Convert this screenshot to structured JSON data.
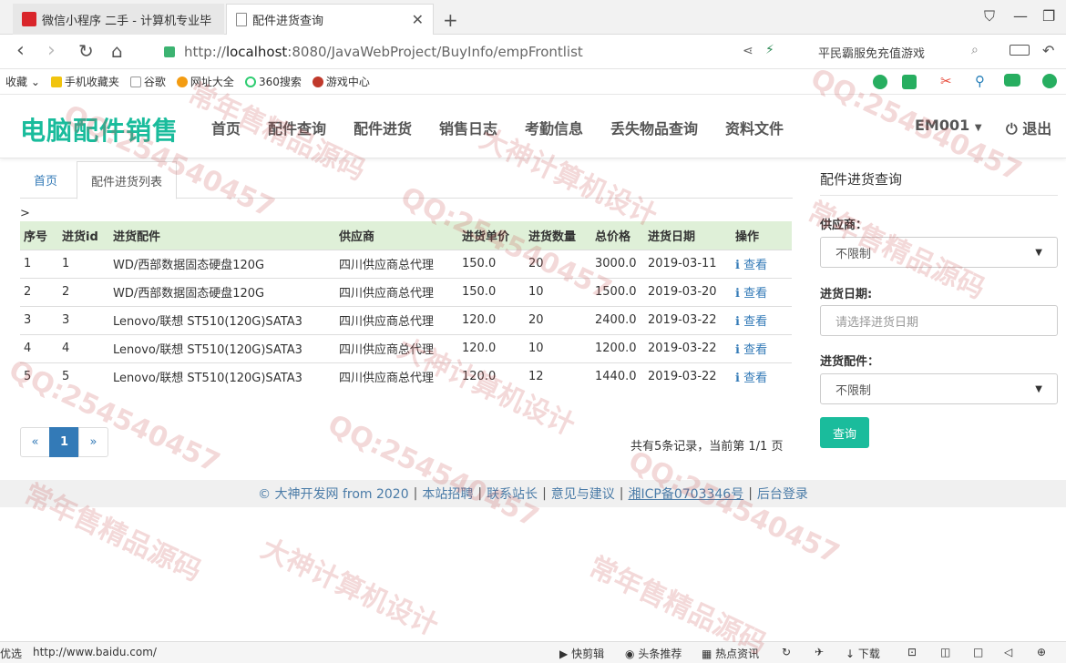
{
  "browser": {
    "tabs": [
      {
        "title": "微信小程序 二手 - 计算机专业毕"
      },
      {
        "title": "配件进货查询"
      }
    ],
    "new_tab": "+",
    "url_prefix": "http://",
    "url_host": "localhost",
    "url_rest": ":8080/JavaWebProject/BuyInfo/empFrontlist",
    "search_hint": "平民霸服免充值游戏",
    "bookmarks": [
      "收藏",
      "手机收藏夹",
      "谷歌",
      "网址大全",
      "360搜索",
      "游戏中心"
    ],
    "status_url": "http://www.baidu.com/",
    "status_left": "优选",
    "status_items": [
      "快剪辑",
      "头条推荐",
      "热点资讯",
      "下载"
    ]
  },
  "site": {
    "brand": "电脑配件销售",
    "menu": [
      "首页",
      "配件查询",
      "配件进货",
      "销售日志",
      "考勤信息",
      "丢失物品查询",
      "资料文件"
    ],
    "user": "EM001",
    "logout": "退出"
  },
  "content": {
    "tabs": [
      "首页",
      "配件进货列表"
    ],
    "breadcrumb_gt": ">",
    "table": {
      "headers": [
        "序号",
        "进货id",
        "进货配件",
        "供应商",
        "进货单价",
        "进货数量",
        "总价格",
        "进货日期",
        "操作"
      ],
      "rows": [
        [
          "1",
          "1",
          "WD/西部数据固态硬盘120G",
          "四川供应商总代理",
          "150.0",
          "20",
          "3000.0",
          "2019-03-11",
          "查看"
        ],
        [
          "2",
          "2",
          "WD/西部数据固态硬盘120G",
          "四川供应商总代理",
          "150.0",
          "10",
          "1500.0",
          "2019-03-20",
          "查看"
        ],
        [
          "3",
          "3",
          "Lenovo/联想 ST510(120G)SATA3",
          "四川供应商总代理",
          "120.0",
          "20",
          "2400.0",
          "2019-03-22",
          "查看"
        ],
        [
          "4",
          "4",
          "Lenovo/联想 ST510(120G)SATA3",
          "四川供应商总代理",
          "120.0",
          "10",
          "1200.0",
          "2019-03-22",
          "查看"
        ],
        [
          "5",
          "5",
          "Lenovo/联想 ST510(120G)SATA3",
          "四川供应商总代理",
          "120.0",
          "12",
          "1440.0",
          "2019-03-22",
          "查看"
        ]
      ]
    },
    "pagination": {
      "prev": "«",
      "current": "1",
      "next": "»"
    },
    "page_info": "共有5条记录，当前第 1/1 页"
  },
  "sidebar": {
    "title": "配件进货查询",
    "supplier_label": "供应商：",
    "supplier_value": "不限制",
    "date_label": "进货日期:",
    "date_placeholder": "请选择进货日期",
    "part_label": "进货配件：",
    "part_value": "不限制",
    "query_button": "查询"
  },
  "footer": {
    "copyright": "© 大神开发网 from 2020",
    "links": [
      "本站招聘",
      "联系站长",
      "意见与建议"
    ],
    "icp": "湘ICP备0703346号",
    "admin": "后台登录",
    "sep": "|"
  },
  "watermark": {
    "texts": [
      "QQ:254540457",
      "大神计算机设计",
      "常年售精品源码"
    ]
  },
  "colors": {
    "brand": "#1abc9c",
    "link": "#337ab7",
    "table_head": "#dff0d8"
  }
}
